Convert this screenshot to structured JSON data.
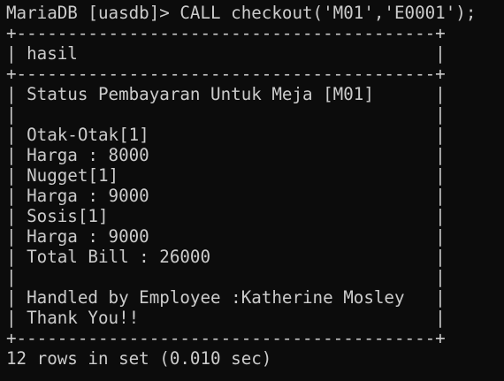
{
  "terminal": {
    "command_line": "MariaDB [uasdb]> CALL checkout('M01','E0001');",
    "table": {
      "border": "+-----------------------------------------+",
      "header": "| hasil                                   |",
      "rows": [
        "| Status Pembayaran Untuk Meja [M01]      |",
        "|                                         |",
        "| Otak-Otak[1]                            |",
        "| Harga : 8000                            |",
        "| Nugget[1]                               |",
        "| Harga : 9000                            |",
        "| Sosis[1]                                |",
        "| Harga : 9000                            |",
        "| Total Bill : 26000                      |",
        "|                                         |",
        "| Handled by Employee :Katherine Mosley   |",
        "| Thank You!!                             |"
      ]
    },
    "result_summary": "12 rows in set (0.010 sec)"
  }
}
